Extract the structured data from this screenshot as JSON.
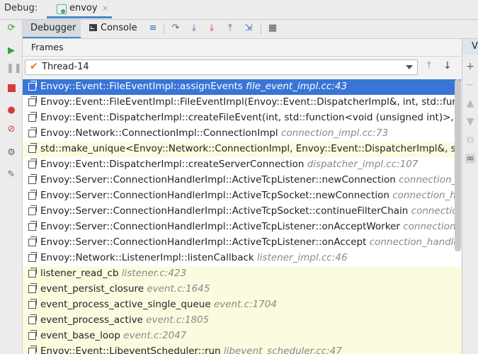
{
  "header": {
    "debug_label": "Debug:",
    "tab_label": "envoy",
    "tab_close": "×"
  },
  "toolbar": {
    "debugger_tab": "Debugger",
    "console_tab": "Console"
  },
  "frames": {
    "title": "Frames",
    "thread": "Thread-14",
    "right_tab_label": "Va",
    "rows": [
      {
        "method": "Envoy::Event::FileEventImpl::assignEvents",
        "file": "file_event_impl.cc:43"
      },
      {
        "method": "Envoy::Event::FileEventImpl::FileEventImpl(Envoy::Event::DispatcherImpl&, int, std::function<void (unsigned int)>, unsi",
        "file": ""
      },
      {
        "method": "Envoy::Event::DispatcherImpl::createFileEvent(int, std::function<void (unsigned int)>, Envoy::Event::FileTriggerType",
        "file": ""
      },
      {
        "method": "Envoy::Network::ConnectionImpl::ConnectionImpl",
        "file": "connection_impl.cc:73"
      },
      {
        "method": "std::make_unique<Envoy::Network::ConnectionImpl, Envoy::Event::DispatcherImpl&, std::unique_ptr<Envoy::Network::Conn",
        "file": ""
      },
      {
        "method": "Envoy::Event::DispatcherImpl::createServerConnection",
        "file": "dispatcher_impl.cc:107"
      },
      {
        "method": "Envoy::Server::ConnectionHandlerImpl::ActiveTcpListener::newConnection",
        "file": "connection_handler_impl.cc"
      },
      {
        "method": "Envoy::Server::ConnectionHandlerImpl::ActiveTcpSocket::newConnection",
        "file": "connection_handler_impl.cc"
      },
      {
        "method": "Envoy::Server::ConnectionHandlerImpl::ActiveTcpSocket::continueFilterChain",
        "file": "connection_handler_impl.cc"
      },
      {
        "method": "Envoy::Server::ConnectionHandlerImpl::ActiveTcpListener::onAcceptWorker",
        "file": "connection_handler_impl.cc"
      },
      {
        "method": "Envoy::Server::ConnectionHandlerImpl::ActiveTcpListener::onAccept",
        "file": "connection_handler_impl.cc"
      },
      {
        "method": "Envoy::Network::ListenerImpl::listenCallback",
        "file": "listener_impl.cc:46"
      },
      {
        "method": "listener_read_cb",
        "file": "listener.c:423"
      },
      {
        "method": "event_persist_closure",
        "file": "event.c:1645"
      },
      {
        "method": "event_process_active_single_queue",
        "file": "event.c:1704"
      },
      {
        "method": "event_process_active",
        "file": "event.c:1805"
      },
      {
        "method": "event_base_loop",
        "file": "event.c:2047"
      },
      {
        "method": "Envoy::Event::LibeventScheduler::run",
        "file": "libevent_scheduler.cc:47"
      }
    ]
  },
  "colors": {
    "selection": "#3875d7",
    "library_row": "#fcfbdf",
    "accent": "#4a88c7"
  }
}
